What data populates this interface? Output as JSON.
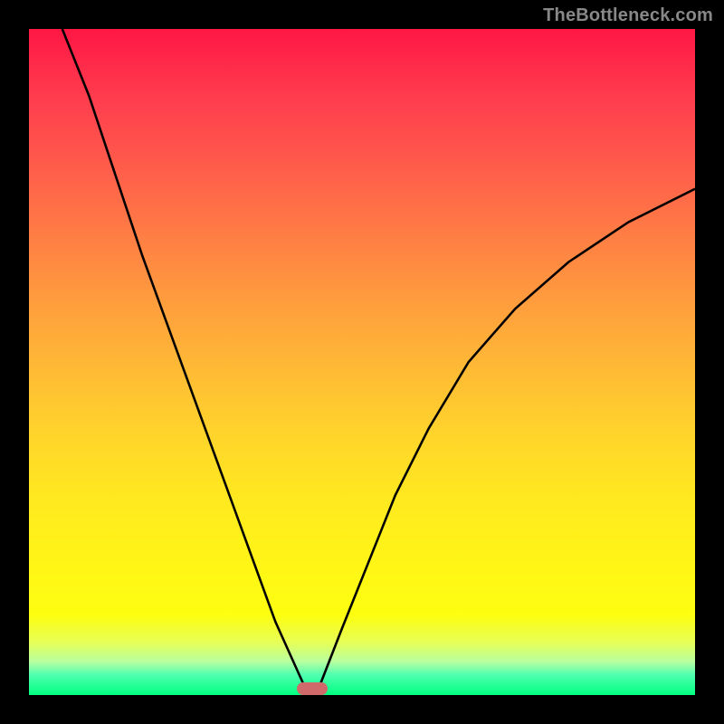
{
  "domain": "Chart",
  "watermark": "TheBottleneck.com",
  "colors": {
    "background": "#000000",
    "gradient_top": "#ff1744",
    "gradient_mid": "#ffd22c",
    "gradient_bottom": "#00ff80",
    "curve": "#000000",
    "marker": "#d06a6a",
    "watermark": "#888888"
  },
  "chart_data": {
    "type": "line",
    "title": "",
    "xlabel": "",
    "ylabel": "",
    "xlim": [
      0,
      100
    ],
    "ylim": [
      0,
      100
    ],
    "grid": false,
    "legend": false,
    "note": "Values are in percent of plot area; y=0 is bottom, y=100 is top. Two branches form a V-shape with minimum at x≈42.",
    "series": [
      {
        "name": "left-branch",
        "x": [
          5,
          9,
          13,
          17,
          21,
          25,
          29,
          33,
          37,
          41.5
        ],
        "values": [
          100,
          90,
          78,
          66,
          55,
          44,
          33,
          22,
          11,
          1
        ]
      },
      {
        "name": "right-branch",
        "x": [
          43.5,
          47,
          51,
          55,
          60,
          66,
          73,
          81,
          90,
          100
        ],
        "values": [
          1,
          10,
          20,
          30,
          40,
          50,
          58,
          65,
          71,
          76
        ]
      }
    ],
    "marker": {
      "x": 42.5,
      "y": 1,
      "shape": "rounded-rect"
    }
  }
}
